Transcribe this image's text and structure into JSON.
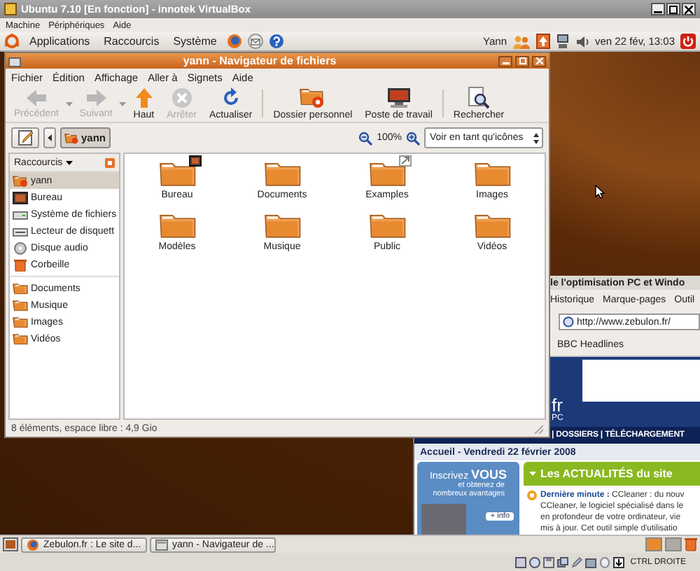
{
  "vbox": {
    "title": "Ubuntu 7.10 [En fonction] - innotek VirtualBox",
    "menu": [
      "Machine",
      "Périphériques",
      "Aide"
    ],
    "host_key": "CTRL DROITE"
  },
  "top_panel": {
    "menus": [
      "Applications",
      "Raccourcis",
      "Système"
    ],
    "user": "Yann",
    "clock": "ven 22 fév, 13:03"
  },
  "file_manager": {
    "title": "yann - Navigateur de fichiers",
    "menu": [
      "Fichier",
      "Édition",
      "Affichage",
      "Aller à",
      "Signets",
      "Aide"
    ],
    "toolbar": [
      {
        "kind": "back",
        "label": "Précédent",
        "disabled": true,
        "dropdown": true
      },
      {
        "kind": "forward",
        "label": "Suivant",
        "disabled": true,
        "dropdown": true
      },
      {
        "kind": "up",
        "label": "Haut",
        "disabled": false
      },
      {
        "kind": "stop",
        "label": "Arrêter",
        "disabled": true
      },
      {
        "kind": "reload",
        "label": "Actualiser",
        "disabled": false
      },
      {
        "kind": "home",
        "label": "Dossier personnel",
        "disabled": false,
        "separator_before": true
      },
      {
        "kind": "computer",
        "label": "Poste de travail",
        "disabled": false
      },
      {
        "kind": "search",
        "label": "Rechercher",
        "disabled": false,
        "separator_before": true
      }
    ],
    "path": [
      {
        "label": "yann",
        "selected": true
      }
    ],
    "zoom": "100%",
    "view": "Voir en tant qu'icônes",
    "sidebar": {
      "title": "Raccourcis",
      "places": [
        {
          "kind": "home",
          "label": "yann",
          "selected": true
        },
        {
          "kind": "desktop",
          "label": "Bureau",
          "selected": false
        },
        {
          "kind": "drive",
          "label": "Système de fichiers",
          "selected": false
        },
        {
          "kind": "floppy",
          "label": "Lecteur de disquett",
          "selected": false
        },
        {
          "kind": "cdrom",
          "label": "Disque audio",
          "selected": false
        },
        {
          "kind": "trash",
          "label": "Corbeille",
          "selected": false
        }
      ],
      "bookmarks": [
        {
          "label": "Documents",
          "selected": false
        },
        {
          "label": "Musique",
          "selected": false
        },
        {
          "label": "Images",
          "selected": false
        },
        {
          "label": "Vidéos",
          "selected": false
        }
      ]
    },
    "files": [
      {
        "name": "Bureau",
        "kind": "desktop"
      },
      {
        "name": "Documents",
        "kind": "plain"
      },
      {
        "name": "Examples",
        "kind": "link"
      },
      {
        "name": "Images",
        "kind": "plain"
      },
      {
        "name": "Modèles",
        "kind": "plain"
      },
      {
        "name": "Musique",
        "kind": "plain"
      },
      {
        "name": "Public",
        "kind": "plain"
      },
      {
        "name": "Vidéos",
        "kind": "plain"
      }
    ],
    "status": "8 éléments, espace libre : 4,9 Gio"
  },
  "browser": {
    "title": "le l'optimisation PC et Windo",
    "menu": [
      "Historique",
      "Marque-pages",
      "Outil"
    ],
    "url": "http://www.zebulon.fr/",
    "bookmarks": [
      "BBC Headlines"
    ],
    "logo": [
      "fr",
      "PC"
    ],
    "nav": "| DOSSIERS | TÉLÉCHARGEMENT",
    "breadcrumb": "Accueil - Vendredi 22 février 2008",
    "ad": {
      "headline": "Inscrivez **VOUS**",
      "text": "et obtenez de nombreux avantages",
      "button": "+ info"
    },
    "news": {
      "title": "Les ACTUALITÉS du site",
      "lines": [
        "**Dernière minute :** CCleaner : du nouv",
        "CCleaner, le logiciel spécialisé dans le",
        "en profondeur de votre ordinateur, vie",
        "mis à jour. Cet outil simple d'utilisatio"
      ]
    }
  },
  "bottom_panel": {
    "tasks": [
      {
        "kind": "browser",
        "label": "Zebulon.fr : Le site d...",
        "selected": false
      },
      {
        "kind": "files",
        "label": "yann - Navigateur de ...",
        "selected": false
      }
    ],
    "workspaces": [
      {
        "selected": true
      },
      {
        "selected": false
      }
    ]
  }
}
